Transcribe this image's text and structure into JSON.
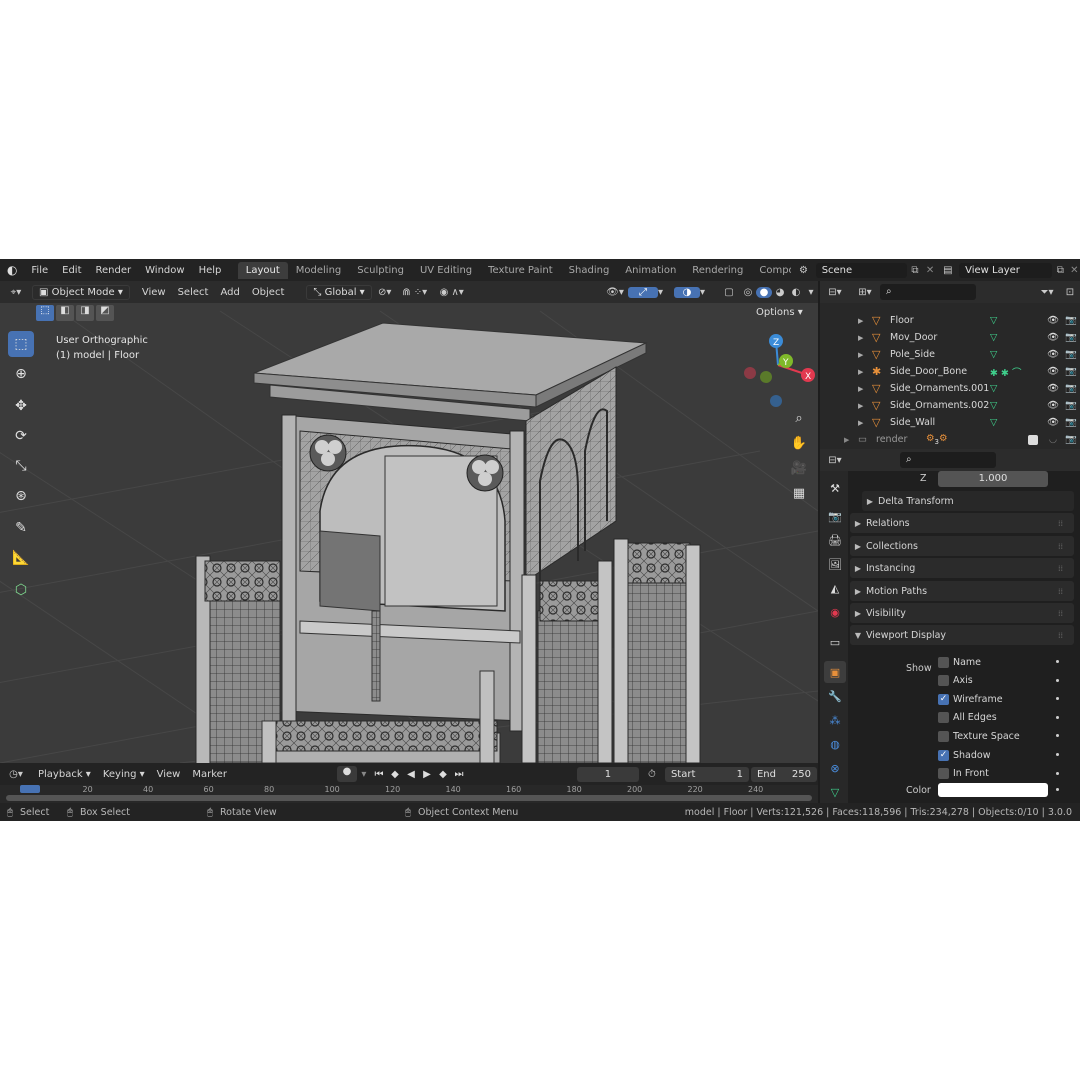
{
  "topbar": {
    "menus": [
      "File",
      "Edit",
      "Render",
      "Window",
      "Help"
    ],
    "workspaces": [
      "Layout",
      "Modeling",
      "Sculpting",
      "UV Editing",
      "Texture Paint",
      "Shading",
      "Animation",
      "Rendering",
      "Compo"
    ],
    "active_workspace": "Layout",
    "scene": "Scene",
    "view_layer": "View Layer"
  },
  "viewport": {
    "mode": "Object Mode",
    "menus": [
      "View",
      "Select",
      "Add",
      "Object"
    ],
    "orientation": "Global",
    "options_label": "Options",
    "view_name": "User Orthographic",
    "context": "(1) model | Floor",
    "axes": {
      "x": "X",
      "y": "Y",
      "z": "Z"
    }
  },
  "timeline": {
    "menus": [
      "Playback",
      "Keying",
      "View",
      "Marker"
    ],
    "current_frame": "1",
    "start_label": "Start",
    "start": "1",
    "end_label": "End",
    "end": "250",
    "ruler": [
      "0",
      "20",
      "40",
      "60",
      "80",
      "100",
      "120",
      "140",
      "160",
      "180",
      "200",
      "220",
      "240"
    ]
  },
  "statusbar": {
    "select": "Select",
    "box_select": "Box Select",
    "rotate": "Rotate View",
    "context_menu": "Object Context Menu",
    "stats": "model | Floor | Verts:121,526 | Faces:118,596 | Tris:234,278 | Objects:0/10 | 3.0.0"
  },
  "outliner": {
    "rows": [
      {
        "name": "Floor",
        "icon": "mesh-icon"
      },
      {
        "name": "Mov_Door",
        "icon": "mesh-icon"
      },
      {
        "name": "Pole_Side",
        "icon": "mesh-icon"
      },
      {
        "name": "Side_Door_Bone",
        "icon": "armature-icon"
      },
      {
        "name": "Side_Ornaments.001",
        "icon": "mesh-icon"
      },
      {
        "name": "Side_Ornaments.002",
        "icon": "mesh-icon"
      },
      {
        "name": "Side_Wall",
        "icon": "mesh-icon"
      }
    ],
    "collection": "render",
    "collection_count": "3"
  },
  "properties": {
    "z_label": "Z",
    "z_value": "1.000",
    "panels": [
      "Delta Transform",
      "Relations",
      "Collections",
      "Instancing",
      "Motion Paths",
      "Visibility",
      "Viewport Display"
    ],
    "show_label": "Show",
    "checks": [
      {
        "label": "Name",
        "checked": false
      },
      {
        "label": "Axis",
        "checked": false
      },
      {
        "label": "Wireframe",
        "checked": true
      },
      {
        "label": "All Edges",
        "checked": false
      },
      {
        "label": "Texture Space",
        "checked": false
      },
      {
        "label": "Shadow",
        "checked": true
      },
      {
        "label": "In Front",
        "checked": false
      }
    ],
    "color_label": "Color",
    "color_value": "#ffffff"
  },
  "colors": {
    "accent": "#4772b3",
    "mesh_orange": "#e8903a",
    "mesh_green": "#3fd08c",
    "axis_x": "#e2394f",
    "axis_y": "#7fb92a",
    "axis_z": "#3b8cd8"
  }
}
